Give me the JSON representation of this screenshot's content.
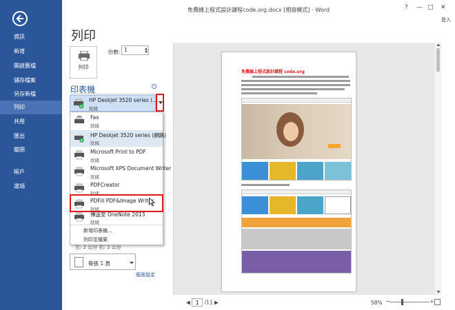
{
  "window": {
    "title": "免費線上程式設計課程code.org.docx [相容模式] - Word",
    "controls": [
      "?",
      "—",
      "□",
      "✕"
    ],
    "login": "登入"
  },
  "nav": {
    "items": [
      {
        "label": "資訊",
        "active": false
      },
      {
        "label": "新增",
        "active": false
      },
      {
        "label": "開啟舊檔",
        "active": false
      },
      {
        "label": "儲存檔案",
        "active": false
      },
      {
        "label": "另存新檔",
        "active": false
      },
      {
        "label": "列印",
        "active": true
      },
      {
        "label": "共用",
        "active": false
      },
      {
        "label": "匯出",
        "active": false
      },
      {
        "label": "關閉",
        "active": false
      },
      {
        "label": "帳戶",
        "active": false
      },
      {
        "label": "選項",
        "active": false
      }
    ]
  },
  "print": {
    "page_title": "列印",
    "print_button": "列印",
    "copies_label": "份數:",
    "copies_value": "1",
    "printer_section": "印表機",
    "selected_printer": {
      "name": "HP Deskjet 3520 series (...",
      "status": "就緒"
    }
  },
  "printers": [
    {
      "name": "Fax",
      "status": "就緒",
      "icon": "fax-printer-icon"
    },
    {
      "name": "HP Deskjet 3520 series (網路)",
      "status": "就緒",
      "icon": "default-printer-icon"
    },
    {
      "name": "Microsoft Print to PDF",
      "status": "就緒",
      "icon": "printer-icon"
    },
    {
      "name": "Microsoft XPS Document Writer",
      "status": "就緒",
      "icon": "printer-icon"
    },
    {
      "name": "PDFCreator",
      "status": "就緒",
      "icon": "printer-icon"
    },
    {
      "name": "PDFill PDF&Image Writer",
      "status": "就緒",
      "icon": "printer-icon"
    },
    {
      "name": "傳送至 OneNote 2013",
      "status": "就緒",
      "icon": "printer-icon"
    }
  ],
  "dropdown_commands": [
    "新增印表機...",
    "列印至檔案"
  ],
  "settings": {
    "margins_text": "左: 2 公分   右: 2 公分",
    "pages_per_sheet": "每張 1 頁",
    "page_setup_link": "版面設定"
  },
  "preview": {
    "doc_title": "免費線上程式設計課程 code.org",
    "page_current": "1",
    "page_total": "/11",
    "zoom": "58%"
  }
}
